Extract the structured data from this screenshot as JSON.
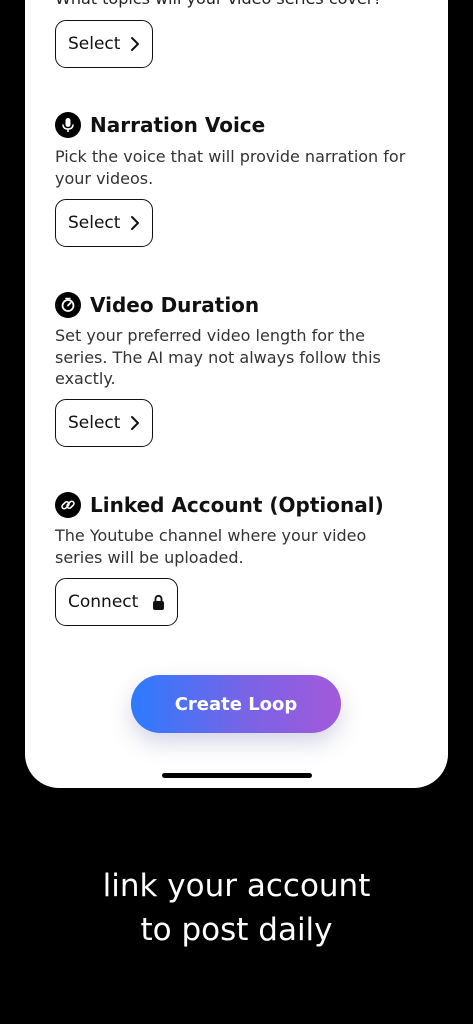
{
  "topics": {
    "question": "What topics will your video series cover?",
    "button": "Select"
  },
  "narration": {
    "title": "Narration Voice",
    "description": "Pick the voice that will provide narration for your videos.",
    "button": "Select",
    "icon": "microphone-icon"
  },
  "duration": {
    "title": "Video Duration",
    "description": "Set your preferred video length for the series. The AI may not always follow this exactly.",
    "button": "Select",
    "icon": "timer-icon"
  },
  "linked": {
    "title": "Linked Account (Optional)",
    "description": "The Youtube channel where your video series will be uploaded.",
    "button": "Connect",
    "icon": "link-icon"
  },
  "cta": {
    "label": "Create Loop",
    "gradient": [
      "#2b7bff",
      "#a259da"
    ]
  },
  "caption": {
    "line1": "link your account",
    "line2": "to post daily"
  },
  "colors": {
    "background": "#000000",
    "card": "#ffffff",
    "text": "#111111"
  }
}
